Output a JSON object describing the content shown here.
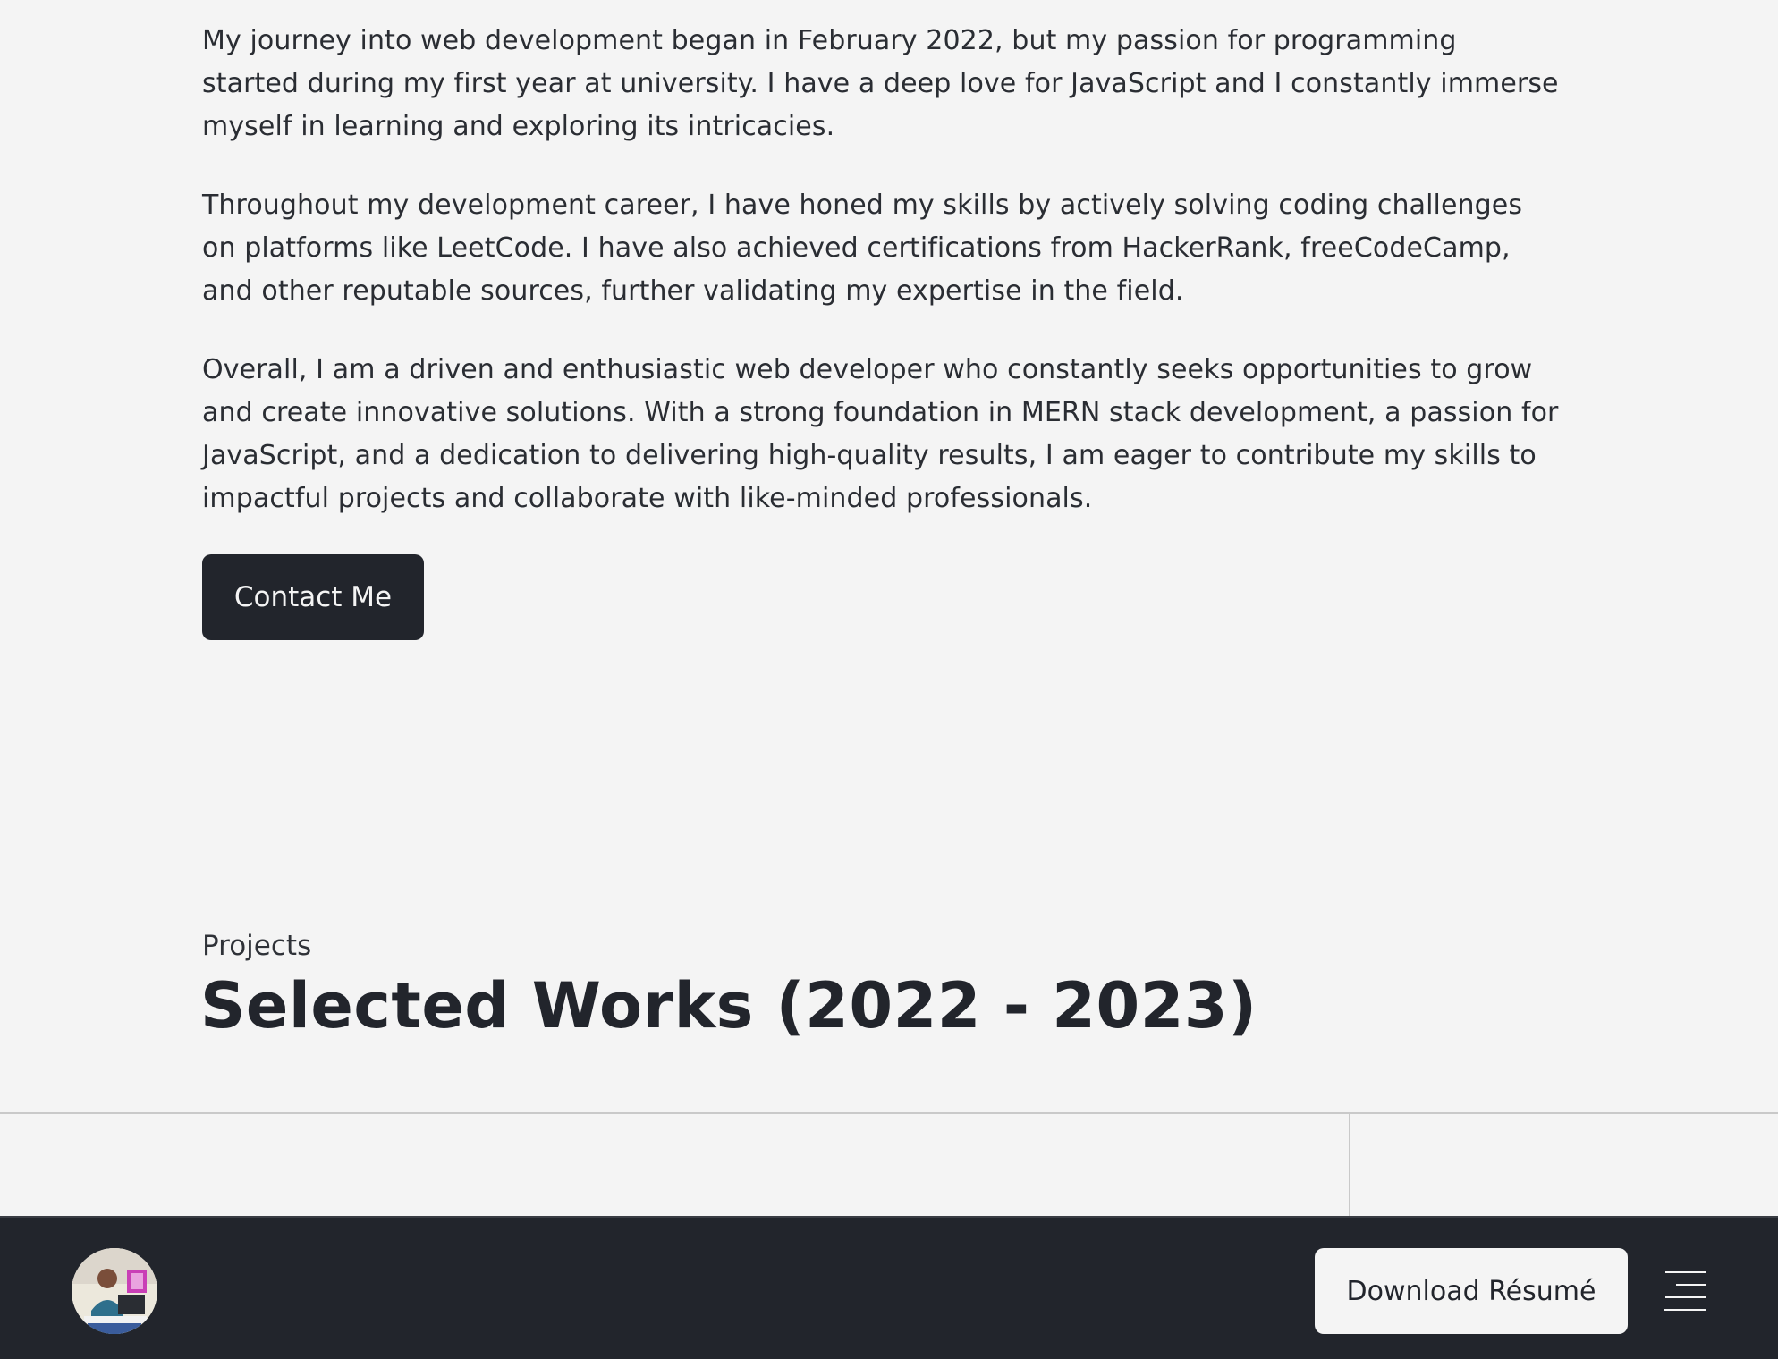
{
  "about": {
    "paragraphs": [
      "My journey into web development began in February 2022, but my passion for programming started during my first year at university. I have a deep love for JavaScript and I constantly immerse myself in learning and exploring its intricacies.",
      "Throughout my development career, I have honed my skills by actively solving coding challenges on platforms like LeetCode. I have also achieved certifications from HackerRank, freeCodeCamp, and other reputable sources, further validating my expertise in the field.",
      "Overall, I am a driven and enthusiastic web developer who constantly seeks opportunities to grow and create innovative solutions. With a strong foundation in MERN stack development, a passion for JavaScript, and a dedication to delivering high-quality results, I am eager to contribute my skills to impactful projects and collaborate with like-minded professionals."
    ],
    "contact_label": "Contact Me"
  },
  "projects": {
    "kicker": "Projects",
    "title": "Selected Works (2022 - 2023)"
  },
  "footer": {
    "download_label": "Download Résumé",
    "menu_icon": "hamburger-menu-icon",
    "avatar_icon": "profile-photo"
  },
  "colors": {
    "background": "#f4f4f4",
    "dark": "#22252c",
    "divider": "#c9c9c9"
  }
}
